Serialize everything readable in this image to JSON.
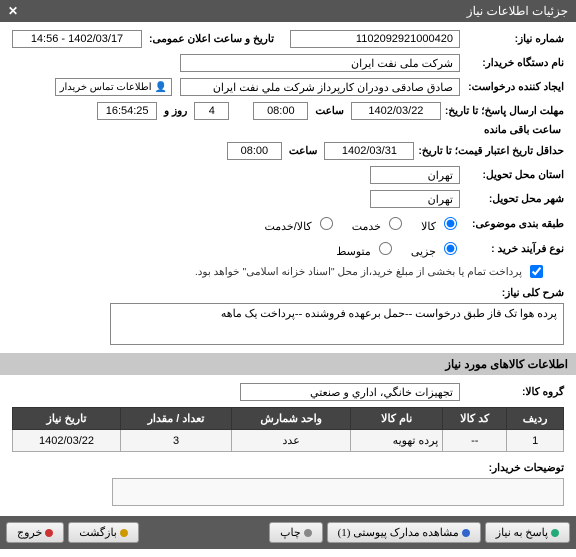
{
  "titlebar": {
    "title": "جزئیات اطلاعات نیاز",
    "close": "✕"
  },
  "fields": {
    "need_number_label": "شماره نیاز:",
    "need_number": "1102092921000420",
    "announce_label": "تاریخ و ساعت اعلان عمومی:",
    "announce_value": "1402/03/17 - 14:56",
    "buyer_org_label": "نام دستگاه خریدار:",
    "buyer_org": "شرکت ملی نفت ایران",
    "creator_label": "ایجاد کننده درخواست:",
    "creator": "صادق صادقی دودران کارپرداز شرکت ملي نفت ايران",
    "contact_btn": "اطلاعات تماس خریدار",
    "deadline_label": "مهلت ارسال پاسخ؛ تا تاریخ:",
    "deadline_date": "1402/03/22",
    "time_label": "ساعت",
    "deadline_time": "08:00",
    "days_label": "روز و",
    "days_value": "4",
    "remain_time": "16:54:25",
    "remain_suffix": "ساعت باقی مانده",
    "validity_label": "حداقل تاریخ اعتبار قیمت؛ تا تاریخ:",
    "validity_date": "1402/03/31",
    "validity_time": "08:00",
    "prov_deliver_label": "استان محل تحویل:",
    "prov_deliver": "تهران",
    "city_deliver_label": "شهر محل تحویل:",
    "city_deliver": "تهران",
    "category_label": "طبقه بندی موضوعی:",
    "cat_goods": "کالا",
    "cat_service": "خدمت",
    "cat_both": "کالا/خدمت",
    "proc_type_label": "نوع فرآیند خرید :",
    "proc_partial": "جزیی",
    "proc_medium": "متوسط",
    "payment_note": "پرداخت تمام یا بخشی از مبلغ خرید،از محل \"اسناد خزانه اسلامی\" خواهد بود.",
    "payment_checkbox_value": "true",
    "summary_label": "شرح کلی نیاز:",
    "summary_text": "پرده هوا تک فاز طبق درخواست --حمل برعهده فروشنده --پرداخت یک ماهه",
    "goods_info_header": "اطلاعات کالاهای مورد نیاز",
    "goods_group_label": "گروه کالا:",
    "goods_group": "تجهيزات خانگي، اداري و صنعتي",
    "buyer_note_label": "توضیحات خریدار:"
  },
  "table": {
    "headers": [
      "ردیف",
      "کد کالا",
      "نام کالا",
      "واحد شمارش",
      "تعداد / مقدار",
      "تاریخ نیاز"
    ],
    "rows": [
      {
        "idx": "1",
        "code": "--",
        "name": "پرده تهویه",
        "unit": "عدد",
        "qty": "3",
        "date": "1402/03/22"
      }
    ]
  },
  "buttons": {
    "respond": "پاسخ به نیاز",
    "attachments": "مشاهده مدارک پیوستی (1)",
    "print": "چاپ",
    "back": "بازگشت",
    "exit": "خروج"
  },
  "icons": {
    "contact": "👤",
    "respond": "#2a7",
    "attach": "#36c",
    "print": "#888",
    "back": "#c90",
    "exit": "#c33"
  }
}
